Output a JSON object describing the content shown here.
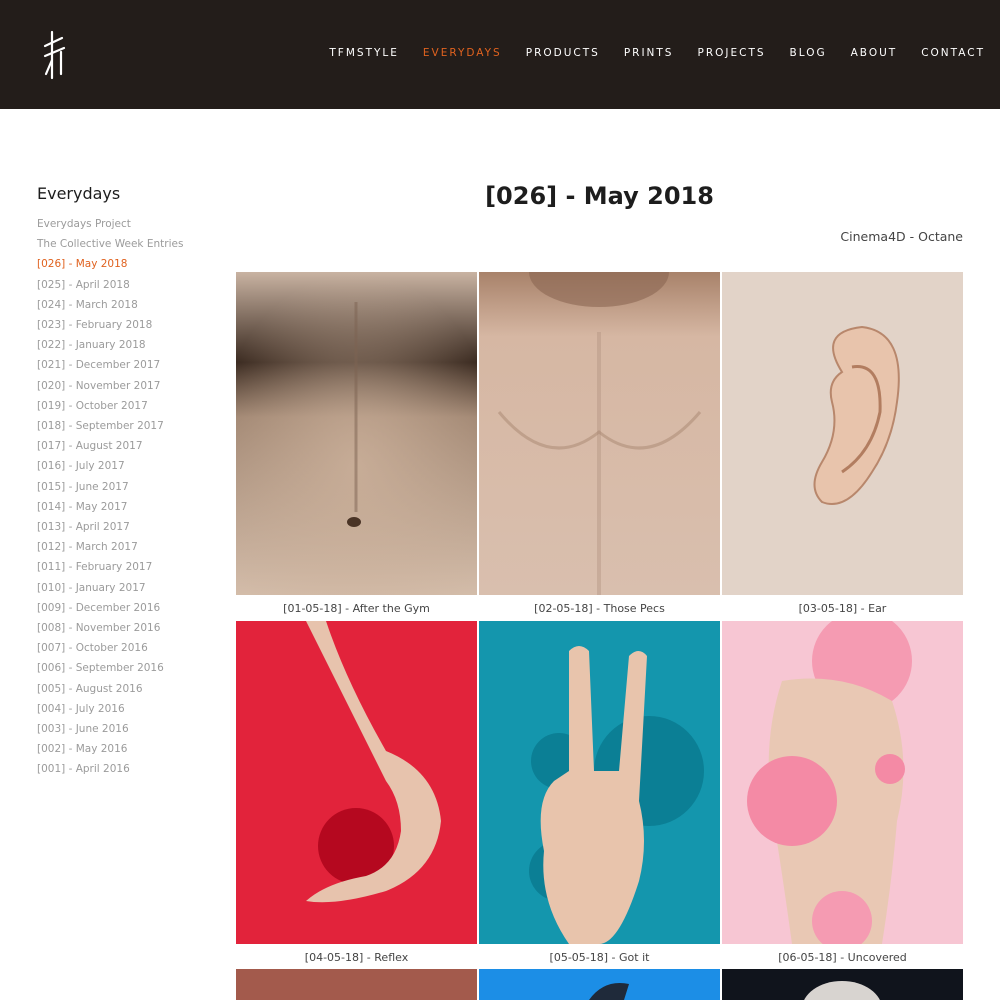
{
  "header": {
    "nav": [
      {
        "label": "TFMSTYLE",
        "active": false
      },
      {
        "label": "EVERYDAYS",
        "active": true
      },
      {
        "label": "PRODUCTS",
        "active": false
      },
      {
        "label": "PRINTS",
        "active": false
      },
      {
        "label": "PROJECTS",
        "active": false
      },
      {
        "label": "BLOG",
        "active": false
      },
      {
        "label": "ABOUT",
        "active": false
      },
      {
        "label": "CONTACT",
        "active": false
      }
    ],
    "logo_icon": "tfm-logo-icon"
  },
  "sidebar": {
    "title": "Everydays",
    "items": [
      "Everydays Project",
      "The Collective Week Entries",
      "[026] - May 2018",
      "[025] - April 2018",
      "[024] - March 2018",
      "[023] - February 2018",
      "[022] - January 2018",
      "[021] - December 2017",
      "[020] - November 2017",
      "[019] - October 2017",
      "[018] - September 2017",
      "[017] - August 2017",
      "[016] - July 2017",
      "[015] - June 2017",
      "[014] - May 2017",
      "[013] - April 2017",
      "[012] - March 2017",
      "[011] - February 2017",
      "[010] - January 2017",
      "[009] - December 2016",
      "[008] - November 2016",
      "[007] - October 2016",
      "[006] - September 2016",
      "[005] - August 2016",
      "[004] - July 2016",
      "[003] - June 2016",
      "[002] - May 2016",
      "[001] - April 2016"
    ],
    "active_item": "[026] - May 2018"
  },
  "main": {
    "title": "[026] - May 2018",
    "subtitle": "Cinema4D - Octane",
    "tiles": [
      {
        "caption": "[01-05-18] - After the Gym"
      },
      {
        "caption": "[02-05-18] - Those Pecs"
      },
      {
        "caption": "[03-05-18] - Ear"
      },
      {
        "caption": "[04-05-18] - Reflex"
      },
      {
        "caption": "[05-05-18] - Got it"
      },
      {
        "caption": "[06-05-18] - Uncovered"
      }
    ]
  },
  "colors": {
    "header_bg": "#231d1a",
    "accent": "#e0621f",
    "sidebar_link": "#9b9b9b"
  }
}
